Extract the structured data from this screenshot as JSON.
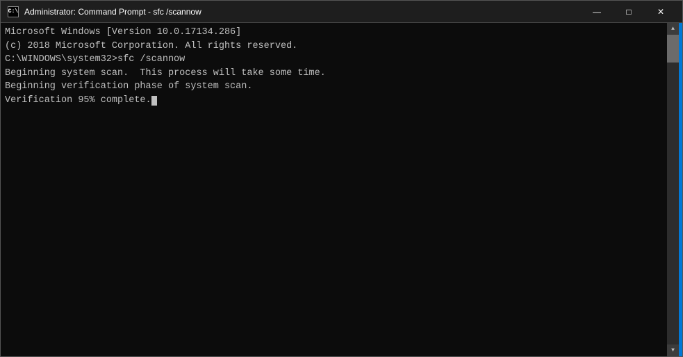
{
  "window": {
    "title": "Administrator: Command Prompt - sfc /scannow",
    "icon": "cmd"
  },
  "controls": {
    "minimize": "—",
    "maximize": "□",
    "close": "✕"
  },
  "terminal": {
    "lines": [
      "Microsoft Windows [Version 10.0.17134.286]",
      "(c) 2018 Microsoft Corporation. All rights reserved.",
      "",
      "C:\\WINDOWS\\system32>sfc /scannow",
      "",
      "Beginning system scan.  This process will take some time.",
      "",
      "Beginning verification phase of system scan.",
      "Verification 95% complete."
    ]
  }
}
